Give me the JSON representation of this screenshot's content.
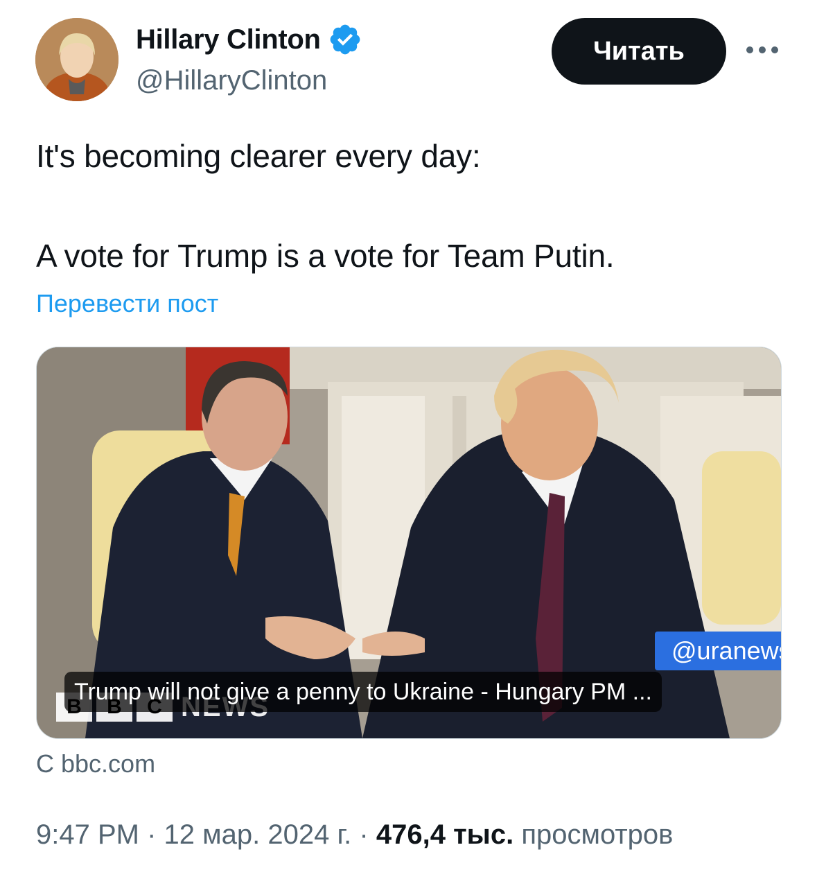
{
  "author": {
    "display_name": "Hillary Clinton",
    "handle": "@HillaryClinton",
    "verified": true,
    "verified_color": "#1d9bf0",
    "avatar_icon": "profile-photo"
  },
  "follow_button": {
    "label": "Читать"
  },
  "more_menu": {
    "icon": "more-horizontal-icon"
  },
  "tweet": {
    "line1": "It's becoming clearer every day:",
    "line2": "A vote for Trump is a vote for Team Putin.",
    "translate_label": "Перевести пост"
  },
  "media_card": {
    "watermark": "@uranews",
    "headline": "Trump will not give a penny to Ukraine - Hungary PM ...",
    "logo_letters": [
      "B",
      "B",
      "C"
    ],
    "logo_word": "NEWS",
    "source": "С bbc.com"
  },
  "meta": {
    "time": "9:47 PM",
    "separator": "·",
    "date": "12 мар. 2024 г.",
    "views_count": "476,4 тыс.",
    "views_label": "просмотров"
  },
  "colors": {
    "text_primary": "#0f1419",
    "text_secondary": "#536471",
    "link": "#1d9bf0",
    "watermark_bg": "#2b6fe0"
  }
}
